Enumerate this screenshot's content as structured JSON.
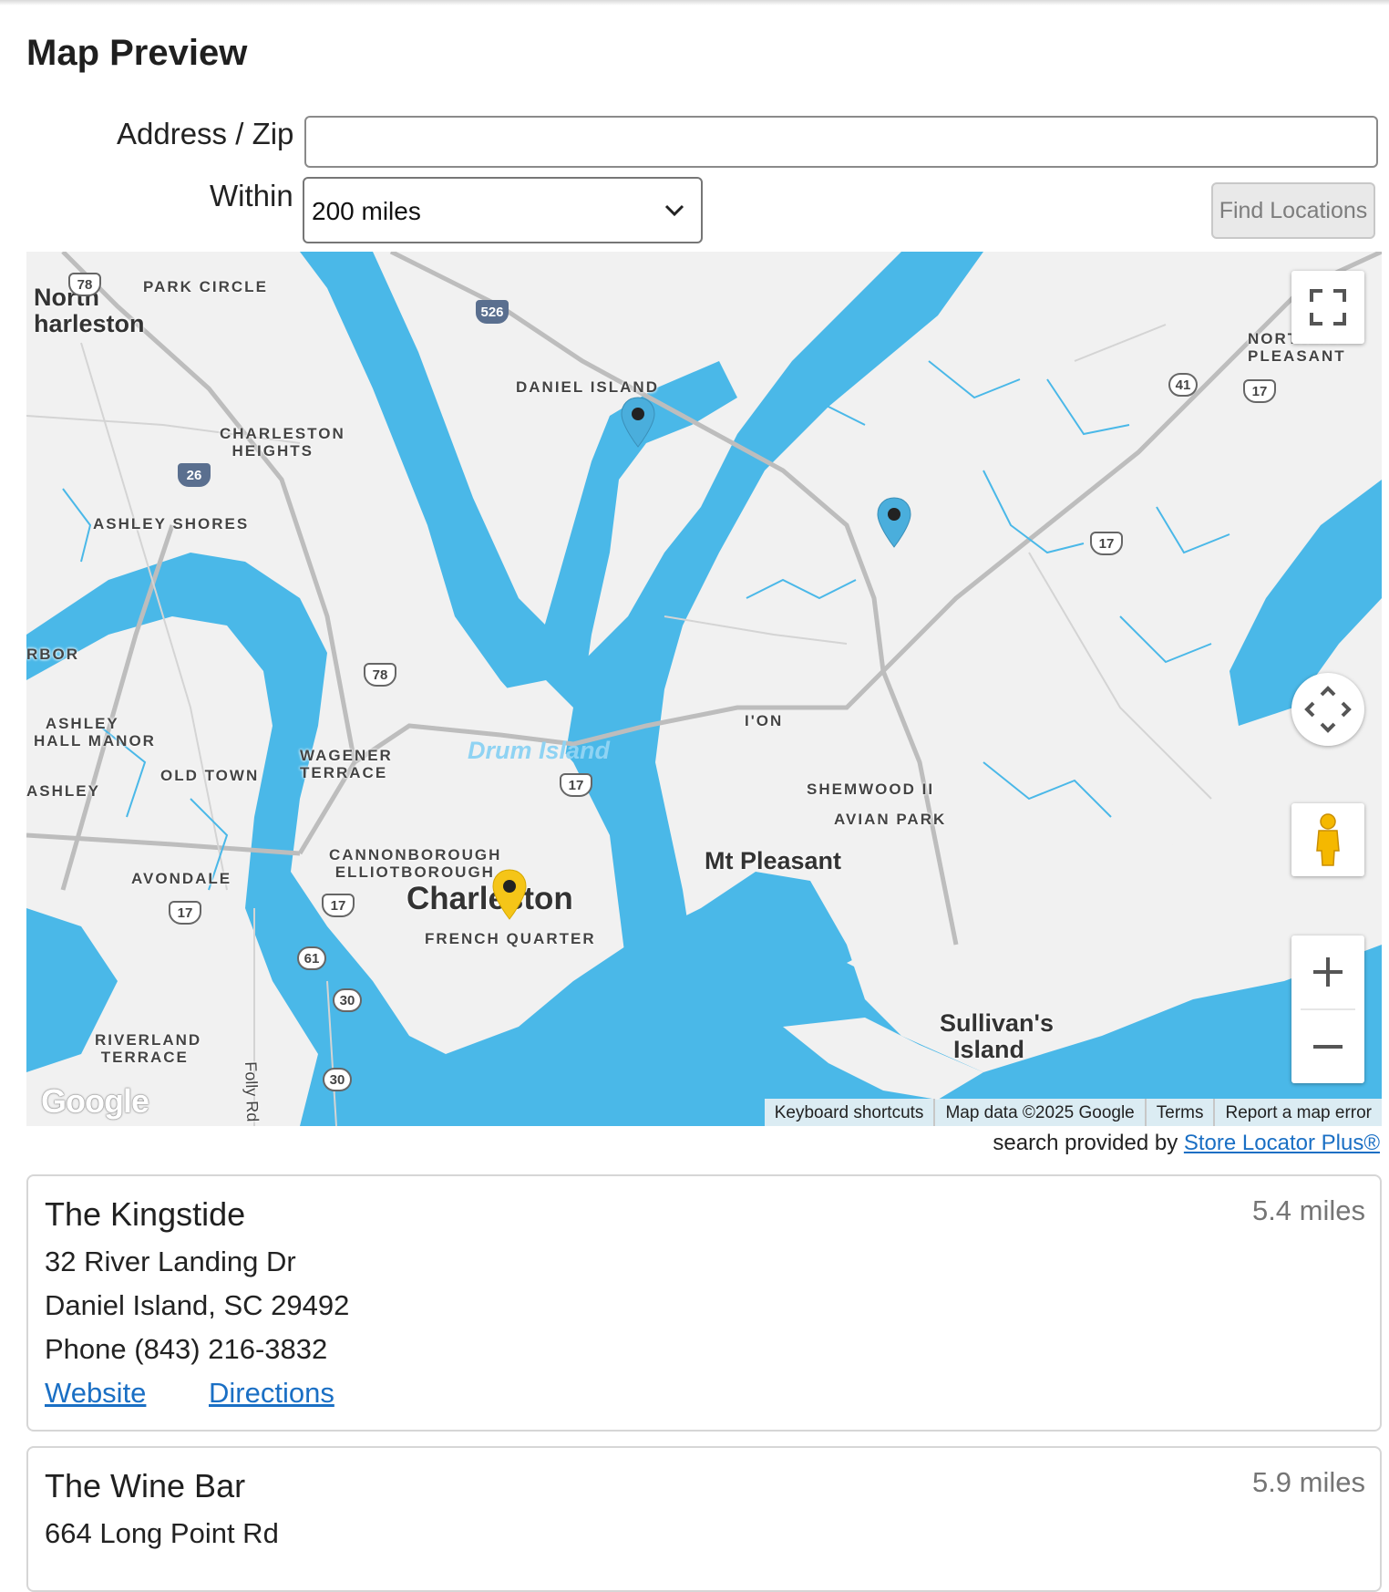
{
  "page": {
    "title": "Map Preview"
  },
  "search": {
    "address_label": "Address / Zip",
    "address_value": "",
    "address_placeholder": "",
    "within_label": "Within",
    "within_selected": "200 miles",
    "find_button": "Find Locations"
  },
  "map": {
    "place_labels": {
      "north_charleston": "North\nharleston",
      "park_circle": "PARK CIRCLE",
      "daniel_island": "DANIEL ISLAND",
      "charleston_heights": "CHARLESTON\n  HEIGHTS",
      "ashley_shores": "ASHLEY SHORES",
      "arbor": "RBOR",
      "ashley_hall_manor": "  ASHLEY\nHALL MANOR",
      "old_town": "OLD TOWN",
      "ashley": "ASHLEY",
      "wagener_terrace": "WAGENER\nTERRACE",
      "avondale": "AVONDALE",
      "cannonborough": "CANNONBOROUGH\n ELLIOTBOROUGH",
      "charleston": "Charleston",
      "french_quarter": "FRENCH QUARTER",
      "riverland_terrace": "RIVERLAND\n TERRACE",
      "folly_rd": "Folly Rd",
      "ion": "I'ON",
      "shemwood": "SHEMWOOD II",
      "avian_park": "AVIAN PARK",
      "mt_pleasant": "Mt Pleasant",
      "sullivans_island": "Sullivan's\n  Island",
      "north_mt_pleasant": "NORTH MT\nPLEASANT",
      "drum_island": "Drum Island"
    },
    "route_shields": {
      "r78_top": "78",
      "r526": "526",
      "r26": "26",
      "r78_mid": "78",
      "r17_bridge": "17",
      "r41": "41",
      "r17_ne": "17",
      "r17_e": "17",
      "r17_w": "17",
      "r17_sw": "17",
      "r61": "61",
      "r30_a": "30",
      "r30_b": "30"
    },
    "google_logo": "Google",
    "attribution": {
      "keyboard": "Keyboard shortcuts",
      "map_data": "Map data ©2025 Google",
      "terms": "Terms",
      "report": "Report a map error"
    },
    "markers": [
      {
        "color": "#4aaedc",
        "label": "The Kingstide"
      },
      {
        "color": "#4aaedc",
        "label": "The Wine Bar"
      },
      {
        "color": "#f5c518",
        "label": "Center"
      }
    ]
  },
  "provided_by": {
    "prefix": "search provided by",
    "link": "Store Locator Plus®"
  },
  "results": [
    {
      "name": "The Kingstide",
      "distance": "5.4 miles",
      "address1": "32 River Landing Dr",
      "address2": "Daniel Island, SC 29492",
      "phone": "Phone (843) 216-3832",
      "website": "Website",
      "directions": "Directions"
    },
    {
      "name": "The Wine Bar",
      "distance": "5.9 miles",
      "address1": "664 Long Point Rd"
    }
  ],
  "colors": {
    "water": "#4ab8e8",
    "land": "#f1f1f1",
    "link": "#1a6fc4",
    "accent_marker": "#f5c518"
  }
}
